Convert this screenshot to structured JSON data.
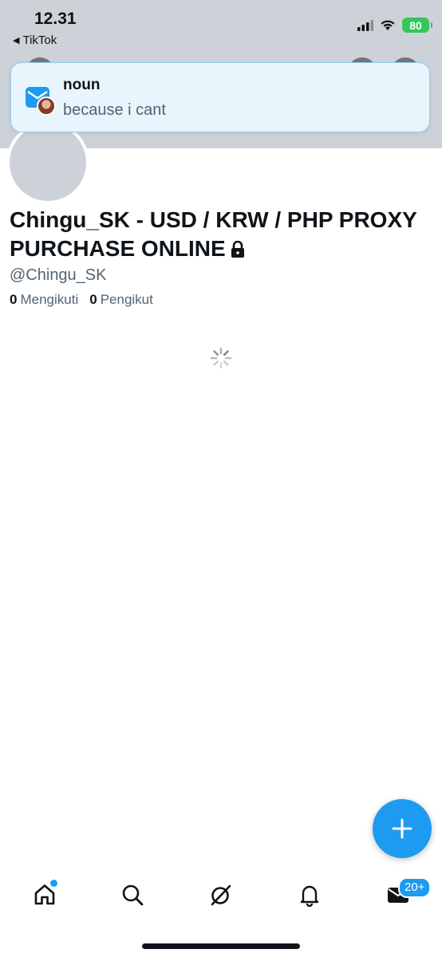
{
  "status_bar": {
    "time": "12.31",
    "back_app": "TikTok",
    "battery": "80"
  },
  "notification": {
    "title": "noun",
    "body": "because i cant"
  },
  "profile": {
    "display_name": "Chingu_SK - USD / KRW / PHP PROXY PURCHASE ONLINE",
    "handle": "@Chingu_SK",
    "following_count": "0",
    "following_label": "Mengikuti",
    "followers_count": "0",
    "followers_label": "Pengikut"
  },
  "tab_bar": {
    "items": [
      "home-icon",
      "search-icon",
      "communities-icon",
      "notifications-icon",
      "messages-icon"
    ],
    "messages_badge": "20+"
  },
  "colors": {
    "accent": "#1d9bf0",
    "banner": "#ccd2d8",
    "text_primary": "#0f1419",
    "text_secondary": "#536471"
  }
}
